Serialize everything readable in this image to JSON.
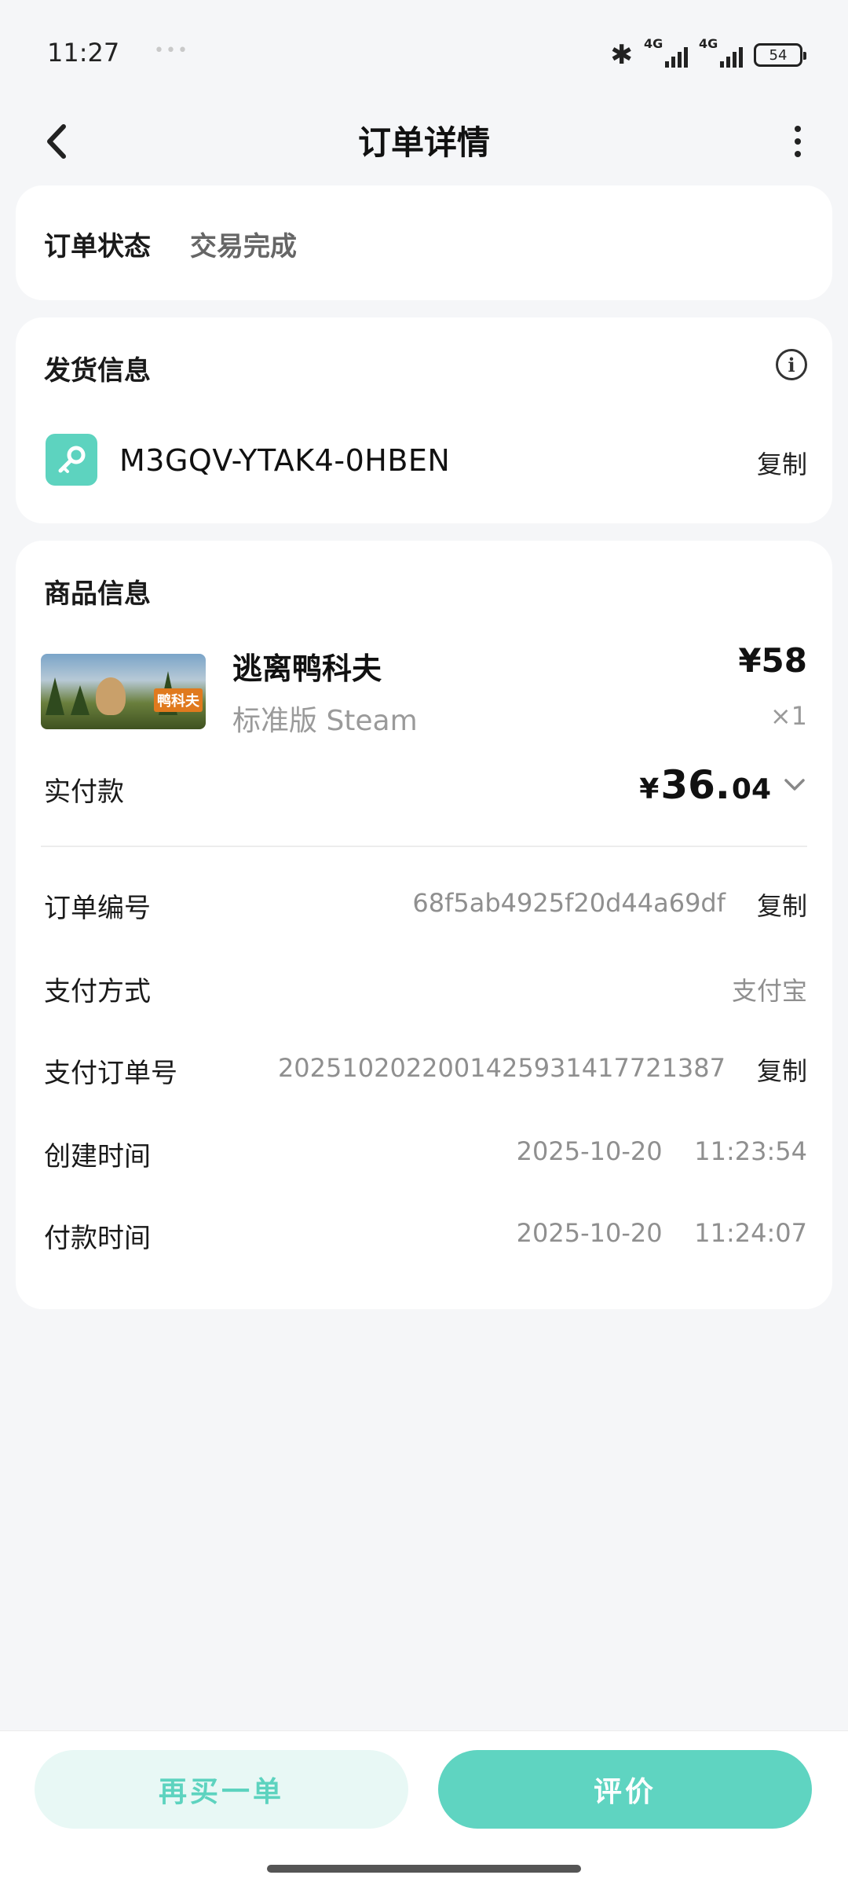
{
  "status_bar": {
    "time": "11:27",
    "dots": "•••",
    "bluetooth_icon": "bluetooth-icon",
    "signal1_tag": "4G",
    "signal2_tag": "4G",
    "battery": "54"
  },
  "header": {
    "title": "订单详情",
    "back_icon": "chevron-left-icon",
    "more_icon": "more-vertical-icon"
  },
  "order_status": {
    "label": "订单状态",
    "value": "交易完成"
  },
  "shipping": {
    "title": "发货信息",
    "info_icon": "info-icon",
    "key_icon": "key-icon",
    "key_code": "M3GQV-YTAK4-0HBEN",
    "copy_label": "复制"
  },
  "goods": {
    "title": "商品信息",
    "thumb_label": "鸭科夫",
    "product_name": "逃离鸭科夫",
    "variant": "标准版 Steam",
    "price": "¥58",
    "quantity": "×1",
    "paid_label": "实付款",
    "paid_currency": "¥",
    "paid_integer": "36.",
    "paid_decimal": "04",
    "expand_icon": "chevron-down-icon"
  },
  "details": {
    "order_no_label": "订单编号",
    "order_no_value": "68f5ab4925f20d44a69df",
    "pay_method_label": "支付方式",
    "pay_method_value": "支付宝",
    "pay_order_label": "支付订单号",
    "pay_order_value": "2025102022001425931417721387",
    "created_label": "创建时间",
    "created_value": "2025-10-20    11:23:54",
    "paid_time_label": "付款时间",
    "paid_time_value": "2025-10-20    11:24:07",
    "copy_label": "复制"
  },
  "actions": {
    "rebuy": "再买一单",
    "review": "评价"
  },
  "colors": {
    "accent": "#5fd4c1",
    "accent_light": "#e8f8f5",
    "background": "#f5f6f8"
  }
}
